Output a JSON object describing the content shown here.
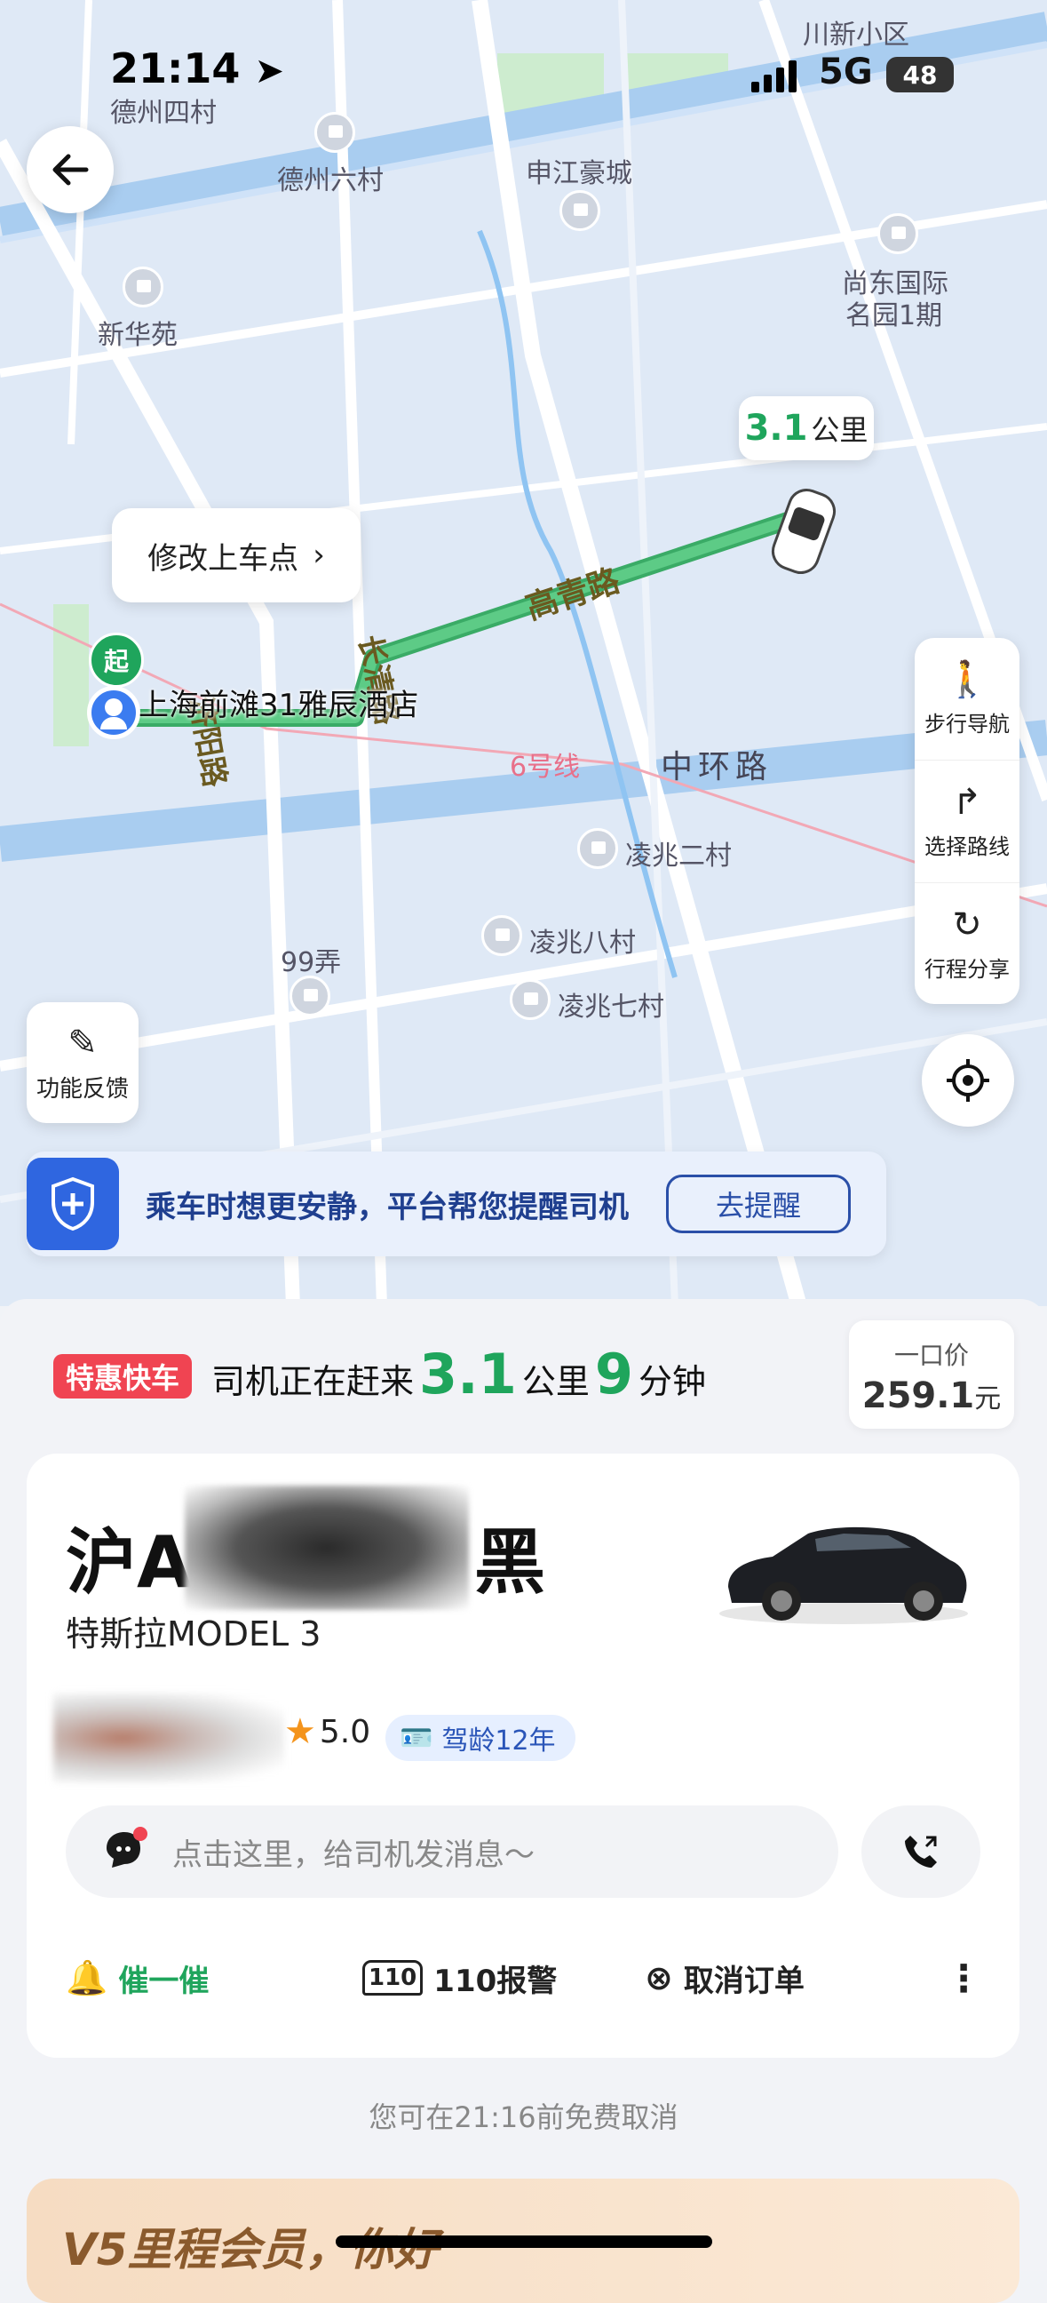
{
  "status_bar": {
    "time": "21:14",
    "network": "5G",
    "battery": "48"
  },
  "map": {
    "labels": {
      "dezhou4": "德州四村",
      "dezhou6": "德州六村",
      "shenjiang": "申江豪城",
      "chuanxin": "川新小区",
      "shangdong1": "尚东国际",
      "shangdong2": "名园1期",
      "xinhua": "新华苑",
      "gaoqing": "高青路",
      "changqing": "长清路",
      "jiyang": "济阳路",
      "line6": "6号线",
      "zhonghuan": "中环路",
      "lingzhao2": "凌兆二村",
      "lingzhao8": "凌兆八村",
      "lingzhao7": "凌兆七村",
      "n99": "99弄",
      "start_marker": "起",
      "pickup_name": "上海前滩31雅辰酒店"
    },
    "pickup_bubble": "修改上车点",
    "distance_bubble": {
      "value": "3.1",
      "unit": "公里"
    },
    "side_panel": [
      {
        "label": "步行导航",
        "icon": "walk-icon"
      },
      {
        "label": "选择路线",
        "icon": "route-icon"
      },
      {
        "label": "行程分享",
        "icon": "share-icon"
      }
    ],
    "feedback": "功能反馈",
    "safety_banner": {
      "text": "乘车时想更安静，平台帮您提醒司机",
      "button": "去提醒"
    }
  },
  "order": {
    "tag": "特惠快车",
    "eta_prefix": "司机正在赶来",
    "eta_distance": "3.1",
    "eta_distance_unit": "公里",
    "eta_minutes": "9",
    "eta_minutes_unit": "分钟",
    "price_label": "一口价",
    "price_value": "259.1",
    "price_unit": "元"
  },
  "driver_card": {
    "plate_prefix": "沪A",
    "plate_suffix": "黑",
    "car_model": "特斯拉MODEL 3",
    "rating": "5.0",
    "drive_age": "驾龄12年",
    "message_placeholder": "点击这里，给司机发消息～",
    "actions": {
      "urge": "催一催",
      "police": "110报警",
      "cancel": "取消订单"
    }
  },
  "cancel_note": "您可在21:16前免费取消",
  "member_banner": "V5里程会员，你好",
  "colors": {
    "green": "#1fa55c",
    "red": "#f04452",
    "blue": "#2f66e0"
  }
}
